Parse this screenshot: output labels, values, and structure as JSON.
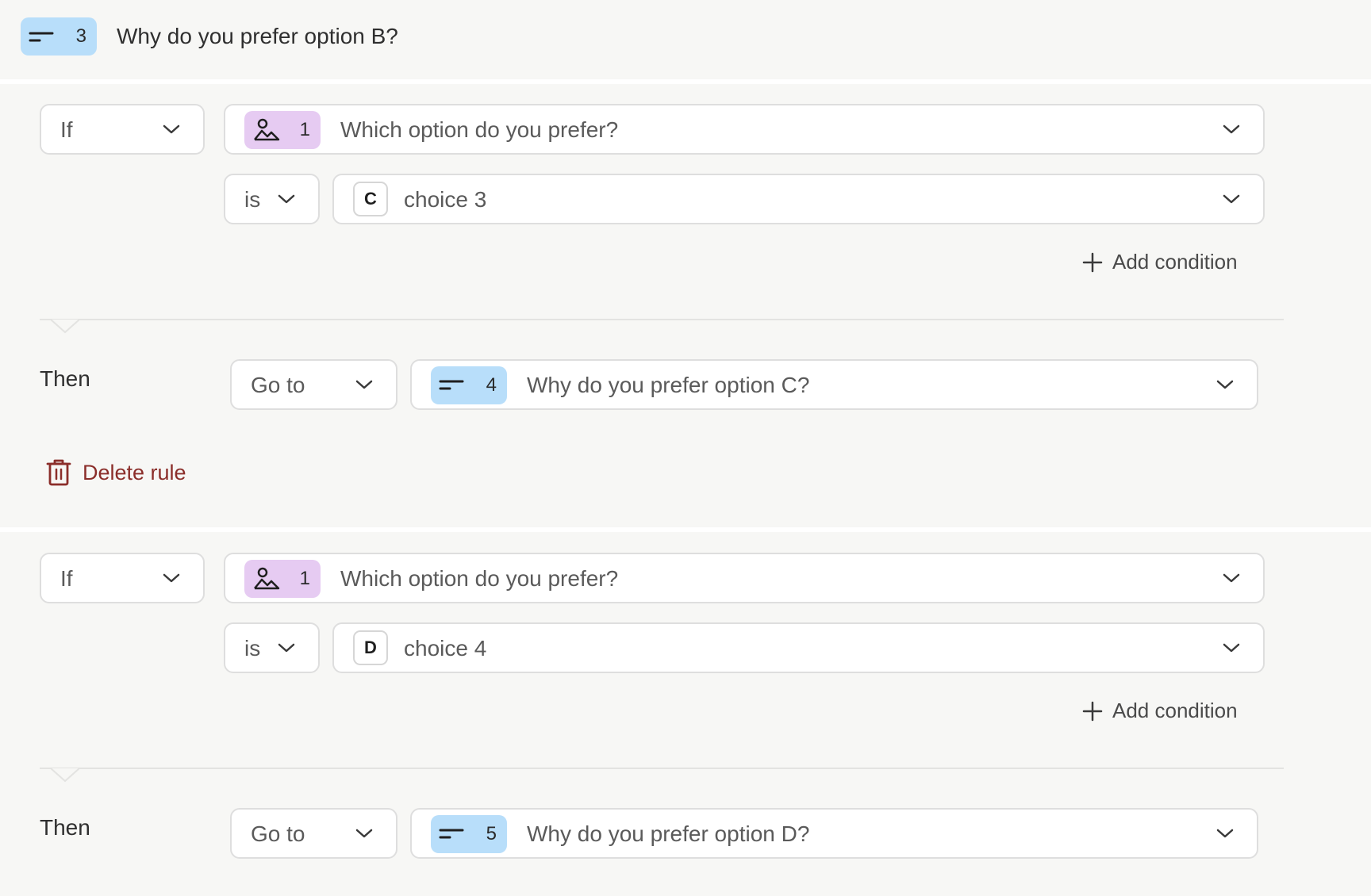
{
  "header": {
    "number": "3",
    "title": "Why do you prefer option B?",
    "icon": "short-text-icon"
  },
  "rules": [
    {
      "if_label": "If",
      "question": {
        "number": "1",
        "title": "Which option do you prefer?",
        "icon": "picture-choice-icon"
      },
      "operator": "is",
      "choice": {
        "letter": "C",
        "label": "choice 3"
      },
      "add_condition": "Add condition",
      "then_label": "Then",
      "action": "Go to",
      "target": {
        "number": "4",
        "title": "Why do you prefer option C?",
        "icon": "short-text-icon"
      },
      "delete": "Delete rule"
    },
    {
      "if_label": "If",
      "question": {
        "number": "1",
        "title": "Which option do you prefer?",
        "icon": "picture-choice-icon"
      },
      "operator": "is",
      "choice": {
        "letter": "D",
        "label": "choice 4"
      },
      "add_condition": "Add condition",
      "then_label": "Then",
      "action": "Go to",
      "target": {
        "number": "5",
        "title": "Why do you prefer option D?",
        "icon": "short-text-icon"
      }
    }
  ],
  "colors": {
    "blue_badge": "#b8defa",
    "purple_badge": "#e6cbf2",
    "delete_red": "#8b2e2a"
  }
}
